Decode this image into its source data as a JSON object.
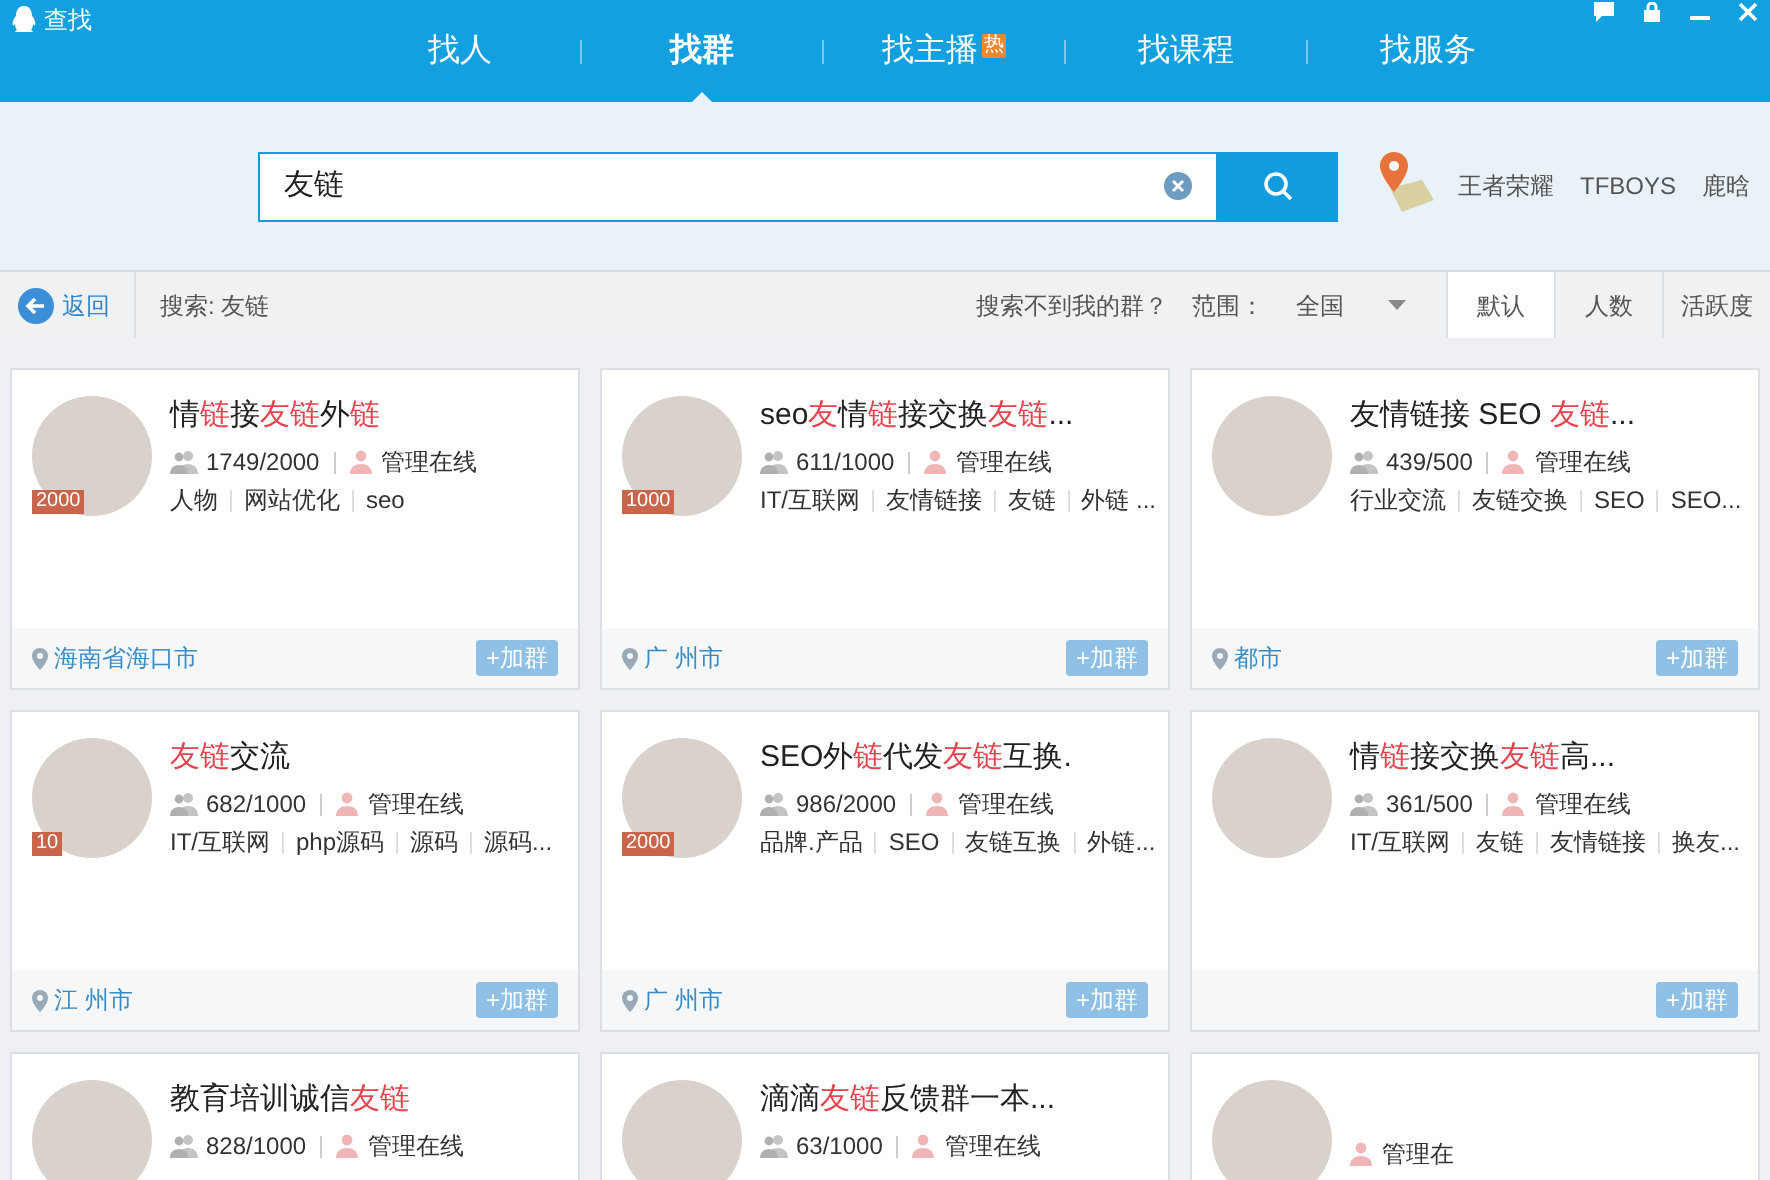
{
  "window": {
    "title": "查找"
  },
  "nav_tabs": [
    {
      "label": "找人",
      "selected": false
    },
    {
      "label": "找群",
      "selected": true
    },
    {
      "label": "找主播",
      "selected": false,
      "badge": "热"
    },
    {
      "label": "找课程",
      "selected": false
    },
    {
      "label": "找服务",
      "selected": false
    }
  ],
  "search": {
    "value": "友链"
  },
  "hot_words": [
    "王者荣耀",
    "TFBOYS",
    "鹿晗"
  ],
  "toolbar": {
    "back": "返回",
    "query": "搜索: 友链",
    "help_link": "搜索不到我的群？",
    "scope_label": "范围：",
    "scope_value": "全国",
    "sort_tabs": [
      {
        "label": "默认",
        "selected": true
      },
      {
        "label": "人数",
        "selected": false
      },
      {
        "label": "活跃度",
        "selected": false
      }
    ]
  },
  "groups": [
    {
      "title": [
        {
          "text": "情",
          "highlight": false
        },
        {
          "text": "链",
          "highlight": true
        },
        {
          "text": "接",
          "highlight": false
        },
        {
          "text": "友链",
          "highlight": true
        },
        {
          "text": "外",
          "highlight": false
        },
        {
          "text": "链",
          "highlight": true
        }
      ],
      "level_badge": "2000",
      "members": "1749/2000",
      "admin": "管理在线",
      "tags": [
        "人物",
        "网站优化",
        "seo"
      ],
      "location": "海南省海口市",
      "join": "+加群"
    },
    {
      "title": [
        {
          "text": "seo",
          "highlight": false
        },
        {
          "text": "友",
          "highlight": true
        },
        {
          "text": "情",
          "highlight": false
        },
        {
          "text": "链",
          "highlight": true
        },
        {
          "text": "接交换",
          "highlight": false
        },
        {
          "text": "友链",
          "highlight": true
        },
        {
          "text": "...",
          "highlight": false
        }
      ],
      "level_badge": "1000",
      "members": "611/1000",
      "admin": "管理在线",
      "tags": [
        "IT/互联网",
        "友情链接",
        "友链",
        "外链 ..."
      ],
      "location": "广 州市",
      "join": "+加群"
    },
    {
      "title": [
        {
          "text": "友情链接 SEO ",
          "highlight": false
        },
        {
          "text": "友链",
          "highlight": true
        },
        {
          "text": "...",
          "highlight": false
        }
      ],
      "members": "439/500",
      "admin": "管理在线",
      "tags": [
        "行业交流",
        "友链交换",
        "SEO",
        "SEO..."
      ],
      "location": "都市",
      "join": "+加群"
    },
    {
      "title": [
        {
          "text": "友链",
          "highlight": true
        },
        {
          "text": "交流",
          "highlight": false
        }
      ],
      "level_badge": "10",
      "members": "682/1000",
      "admin": "管理在线",
      "tags": [
        "IT/互联网",
        "php源码",
        "源码",
        "源码..."
      ],
      "location": "江 州市",
      "join": "+加群"
    },
    {
      "title": [
        {
          "text": "SEO外",
          "highlight": false
        },
        {
          "text": "链",
          "highlight": true
        },
        {
          "text": "代发",
          "highlight": false
        },
        {
          "text": "友链",
          "highlight": true
        },
        {
          "text": "互换.",
          "highlight": false
        }
      ],
      "level_badge": "2000",
      "members": "986/2000",
      "admin": "管理在线",
      "tags": [
        "品牌.产品",
        "SEO",
        "友链互换",
        "外链..."
      ],
      "location": "广 州市",
      "join": "+加群"
    },
    {
      "title": [
        {
          "text": "情",
          "highlight": false
        },
        {
          "text": "链",
          "highlight": true
        },
        {
          "text": "接交换",
          "highlight": false
        },
        {
          "text": "友链",
          "highlight": true
        },
        {
          "text": "高...",
          "highlight": false
        }
      ],
      "members": "361/500",
      "admin": "管理在线",
      "tags": [
        "IT/互联网",
        "友链",
        "友情链接",
        "换友..."
      ],
      "join": "+加群"
    },
    {
      "title": [
        {
          "text": "教育培训诚信",
          "highlight": false
        },
        {
          "text": "友链",
          "highlight": true
        }
      ],
      "members": "828/1000",
      "admin": "管理在线"
    },
    {
      "title": [
        {
          "text": "滴滴",
          "highlight": false
        },
        {
          "text": "友链",
          "highlight": true
        },
        {
          "text": "反馈群一本...",
          "highlight": false
        }
      ],
      "members": "63/1000",
      "admin": "管理在线"
    },
    {
      "admin": "管理在"
    }
  ]
}
